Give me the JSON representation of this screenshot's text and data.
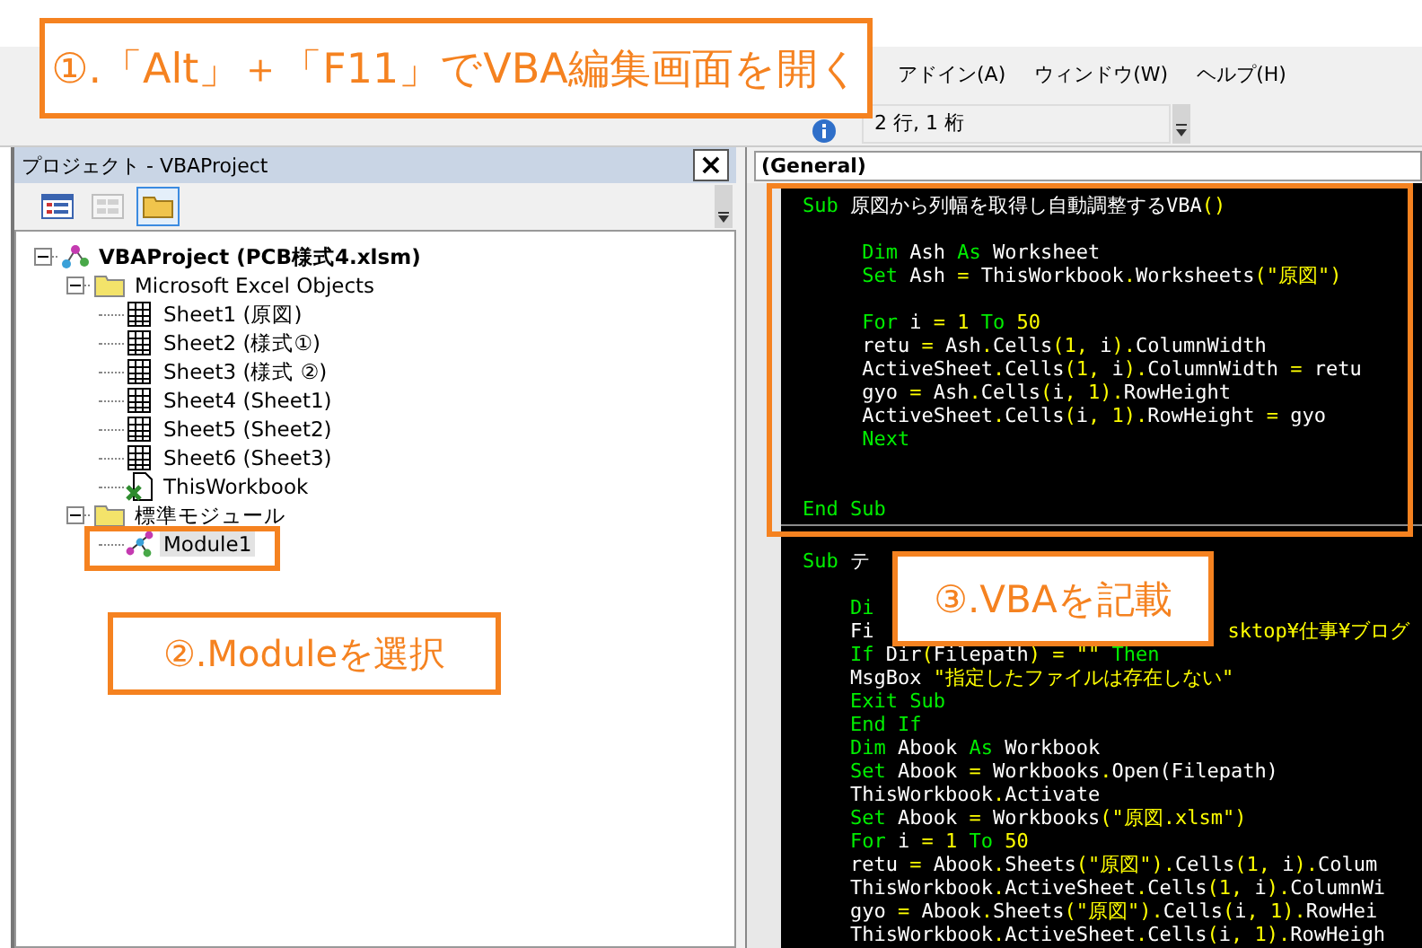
{
  "menu": [
    {
      "label": "アドイン(A)"
    },
    {
      "label": "ウィンドウ(W)"
    },
    {
      "label": "ヘルプ(H)"
    }
  ],
  "toolbar": {
    "position": "2 行, 1 桁"
  },
  "project_panel": {
    "title": "プロジェクト - VBAProject",
    "close": "×",
    "buttons": [
      {
        "kind": "view-code",
        "disabled": false,
        "selected": false
      },
      {
        "kind": "view-object",
        "disabled": true,
        "selected": false
      },
      {
        "kind": "toggle-folders",
        "disabled": false,
        "selected": true
      }
    ],
    "tree": [
      {
        "label": "VBAProject (PCB様式4.xlsm)",
        "kind": "project",
        "expanded": true,
        "selected": false,
        "children": [
          {
            "label": "Microsoft Excel Objects",
            "kind": "folder",
            "expanded": true,
            "selected": false,
            "children": [
              {
                "label": "Sheet1 (原図)",
                "kind": "sheet",
                "selected": false
              },
              {
                "label": "Sheet2 (様式①)",
                "kind": "sheet",
                "selected": false
              },
              {
                "label": "Sheet3 (様式 ②)",
                "kind": "sheet",
                "selected": false
              },
              {
                "label": "Sheet4 (Sheet1)",
                "kind": "sheet",
                "selected": false
              },
              {
                "label": "Sheet5 (Sheet2)",
                "kind": "sheet",
                "selected": false
              },
              {
                "label": "Sheet6 (Sheet3)",
                "kind": "sheet",
                "selected": false
              },
              {
                "label": "ThisWorkbook",
                "kind": "workbook",
                "selected": false
              }
            ]
          },
          {
            "label": "標準モジュール",
            "kind": "folder",
            "expanded": true,
            "selected": false,
            "children": [
              {
                "label": "Module1",
                "kind": "module",
                "selected": true
              }
            ]
          }
        ]
      }
    ]
  },
  "code_window": {
    "object_box": "(General)",
    "procedures": [
      {
        "lines": [
          {
            "kind": "code",
            "segments": [
              {
                "kind": "keyword",
                "text": "Sub "
              },
              {
                "kind": "plain",
                "text": "原図から列幅を取得し自動調整するVBA"
              },
              {
                "kind": "symbol",
                "text": "()"
              }
            ]
          },
          {
            "kind": "blank"
          },
          {
            "kind": "code",
            "segments": [
              {
                "kind": "keyword",
                "text": "     Dim "
              },
              {
                "kind": "plain",
                "text": "Ash "
              },
              {
                "kind": "keyword",
                "text": "As "
              },
              {
                "kind": "plain",
                "text": "Worksheet"
              }
            ]
          },
          {
            "kind": "code",
            "segments": [
              {
                "kind": "keyword",
                "text": "     Set "
              },
              {
                "kind": "plain",
                "text": "Ash "
              },
              {
                "kind": "symbol",
                "text": "= "
              },
              {
                "kind": "plain",
                "text": "ThisWorkbook"
              },
              {
                "kind": "symbol",
                "text": "."
              },
              {
                "kind": "plain",
                "text": "Worksheets"
              },
              {
                "kind": "symbol",
                "text": "(\"原図\")"
              }
            ]
          },
          {
            "kind": "blank"
          },
          {
            "kind": "code",
            "segments": [
              {
                "kind": "keyword",
                "text": "     For "
              },
              {
                "kind": "plain",
                "text": "i "
              },
              {
                "kind": "symbol",
                "text": "= 1 "
              },
              {
                "kind": "keyword",
                "text": "To "
              },
              {
                "kind": "symbol",
                "text": "50"
              }
            ]
          },
          {
            "kind": "code",
            "segments": [
              {
                "kind": "plain",
                "text": "     retu "
              },
              {
                "kind": "symbol",
                "text": "= "
              },
              {
                "kind": "plain",
                "text": "Ash"
              },
              {
                "kind": "symbol",
                "text": "."
              },
              {
                "kind": "plain",
                "text": "Cells"
              },
              {
                "kind": "symbol",
                "text": "(1, "
              },
              {
                "kind": "plain",
                "text": "i"
              },
              {
                "kind": "symbol",
                "text": ")."
              },
              {
                "kind": "plain",
                "text": "ColumnWidth"
              }
            ]
          },
          {
            "kind": "code",
            "segments": [
              {
                "kind": "plain",
                "text": "     ActiveSheet"
              },
              {
                "kind": "symbol",
                "text": "."
              },
              {
                "kind": "plain",
                "text": "Cells"
              },
              {
                "kind": "symbol",
                "text": "(1, "
              },
              {
                "kind": "plain",
                "text": "i"
              },
              {
                "kind": "symbol",
                "text": ")."
              },
              {
                "kind": "plain",
                "text": "ColumnWidth "
              },
              {
                "kind": "symbol",
                "text": "= "
              },
              {
                "kind": "plain",
                "text": "retu"
              }
            ]
          },
          {
            "kind": "code",
            "segments": [
              {
                "kind": "plain",
                "text": "     gyo "
              },
              {
                "kind": "symbol",
                "text": "= "
              },
              {
                "kind": "plain",
                "text": "Ash"
              },
              {
                "kind": "symbol",
                "text": "."
              },
              {
                "kind": "plain",
                "text": "Cells"
              },
              {
                "kind": "symbol",
                "text": "("
              },
              {
                "kind": "plain",
                "text": "i"
              },
              {
                "kind": "symbol",
                "text": ", 1)."
              },
              {
                "kind": "plain",
                "text": "RowHeight"
              }
            ]
          },
          {
            "kind": "code",
            "segments": [
              {
                "kind": "plain",
                "text": "     ActiveSheet"
              },
              {
                "kind": "symbol",
                "text": "."
              },
              {
                "kind": "plain",
                "text": "Cells"
              },
              {
                "kind": "symbol",
                "text": "("
              },
              {
                "kind": "plain",
                "text": "i"
              },
              {
                "kind": "symbol",
                "text": ", 1)."
              },
              {
                "kind": "plain",
                "text": "RowHeight "
              },
              {
                "kind": "symbol",
                "text": "= "
              },
              {
                "kind": "plain",
                "text": "gyo"
              }
            ]
          },
          {
            "kind": "code",
            "segments": [
              {
                "kind": "keyword",
                "text": "     Next"
              }
            ]
          },
          {
            "kind": "blank"
          },
          {
            "kind": "blank"
          },
          {
            "kind": "code",
            "segments": [
              {
                "kind": "keyword",
                "text": "End Sub"
              }
            ]
          }
        ]
      },
      {
        "lines": [
          {
            "kind": "blank"
          },
          {
            "kind": "code",
            "segments": [
              {
                "kind": "keyword",
                "text": "Sub "
              },
              {
                "kind": "plain",
                "text": "テ"
              }
            ]
          },
          {
            "kind": "blank"
          },
          {
            "kind": "code",
            "segments": [
              {
                "kind": "keyword",
                "text": "    Di"
              }
            ]
          },
          {
            "kind": "split",
            "segments": [
              {
                "kind": "plain",
                "text": "    Fi"
              },
              {
                "kind": "symbol",
                "text": "sktop¥仕事¥ブログ"
              }
            ]
          },
          {
            "kind": "code",
            "segments": [
              {
                "kind": "keyword",
                "text": "    If "
              },
              {
                "kind": "plain",
                "text": "Dir"
              },
              {
                "kind": "symbol",
                "text": "("
              },
              {
                "kind": "plain",
                "text": "Filepath"
              },
              {
                "kind": "symbol",
                "text": ") = \"\" "
              },
              {
                "kind": "keyword",
                "text": "Then"
              }
            ]
          },
          {
            "kind": "code",
            "segments": [
              {
                "kind": "plain",
                "text": "    MsgBox "
              },
              {
                "kind": "symbol",
                "text": "\"指定したファイルは存在しない\""
              }
            ]
          },
          {
            "kind": "code",
            "segments": [
              {
                "kind": "keyword",
                "text": "    Exit Sub"
              }
            ]
          },
          {
            "kind": "code",
            "segments": [
              {
                "kind": "keyword",
                "text": "    End If"
              }
            ]
          },
          {
            "kind": "code",
            "segments": [
              {
                "kind": "keyword",
                "text": "    Dim "
              },
              {
                "kind": "plain",
                "text": "Abook "
              },
              {
                "kind": "keyword",
                "text": "As "
              },
              {
                "kind": "plain",
                "text": "Workbook"
              }
            ]
          },
          {
            "kind": "code",
            "segments": [
              {
                "kind": "keyword",
                "text": "    Set "
              },
              {
                "kind": "plain",
                "text": "Abook "
              },
              {
                "kind": "symbol",
                "text": "= "
              },
              {
                "kind": "plain",
                "text": "Workbooks"
              },
              {
                "kind": "symbol",
                "text": "."
              },
              {
                "kind": "plain",
                "text": "Open(Filepath)"
              }
            ]
          },
          {
            "kind": "code",
            "segments": [
              {
                "kind": "plain",
                "text": "    ThisWorkbook"
              },
              {
                "kind": "symbol",
                "text": "."
              },
              {
                "kind": "plain",
                "text": "Activate"
              }
            ]
          },
          {
            "kind": "code",
            "segments": [
              {
                "kind": "keyword",
                "text": "    Set "
              },
              {
                "kind": "plain",
                "text": "Abook "
              },
              {
                "kind": "symbol",
                "text": "= "
              },
              {
                "kind": "plain",
                "text": "Workbooks"
              },
              {
                "kind": "symbol",
                "text": "(\"原図.xlsm\")"
              }
            ]
          },
          {
            "kind": "code",
            "segments": [
              {
                "kind": "keyword",
                "text": "    For "
              },
              {
                "kind": "plain",
                "text": "i "
              },
              {
                "kind": "symbol",
                "text": "= 1 "
              },
              {
                "kind": "keyword",
                "text": "To "
              },
              {
                "kind": "symbol",
                "text": "50"
              }
            ]
          },
          {
            "kind": "code",
            "segments": [
              {
                "kind": "plain",
                "text": "    retu "
              },
              {
                "kind": "symbol",
                "text": "= "
              },
              {
                "kind": "plain",
                "text": "Abook"
              },
              {
                "kind": "symbol",
                "text": "."
              },
              {
                "kind": "plain",
                "text": "Sheets"
              },
              {
                "kind": "symbol",
                "text": "(\"原図\")."
              },
              {
                "kind": "plain",
                "text": "Cells"
              },
              {
                "kind": "symbol",
                "text": "(1, "
              },
              {
                "kind": "plain",
                "text": "i"
              },
              {
                "kind": "symbol",
                "text": ")."
              },
              {
                "kind": "plain",
                "text": "Colum"
              }
            ]
          },
          {
            "kind": "code",
            "segments": [
              {
                "kind": "plain",
                "text": "    ThisWorkbook"
              },
              {
                "kind": "symbol",
                "text": "."
              },
              {
                "kind": "plain",
                "text": "ActiveSheet"
              },
              {
                "kind": "symbol",
                "text": "."
              },
              {
                "kind": "plain",
                "text": "Cells"
              },
              {
                "kind": "symbol",
                "text": "(1, "
              },
              {
                "kind": "plain",
                "text": "i"
              },
              {
                "kind": "symbol",
                "text": ")."
              },
              {
                "kind": "plain",
                "text": "ColumnWi"
              }
            ]
          },
          {
            "kind": "code",
            "segments": [
              {
                "kind": "plain",
                "text": "    gyo "
              },
              {
                "kind": "symbol",
                "text": "= "
              },
              {
                "kind": "plain",
                "text": "Abook"
              },
              {
                "kind": "symbol",
                "text": "."
              },
              {
                "kind": "plain",
                "text": "Sheets"
              },
              {
                "kind": "symbol",
                "text": "(\"原図\")."
              },
              {
                "kind": "plain",
                "text": "Cells"
              },
              {
                "kind": "symbol",
                "text": "("
              },
              {
                "kind": "plain",
                "text": "i"
              },
              {
                "kind": "symbol",
                "text": ", 1)."
              },
              {
                "kind": "plain",
                "text": "RowHei"
              }
            ]
          },
          {
            "kind": "code",
            "segments": [
              {
                "kind": "plain",
                "text": "    ThisWorkbook"
              },
              {
                "kind": "symbol",
                "text": "."
              },
              {
                "kind": "plain",
                "text": "ActiveSheet"
              },
              {
                "kind": "symbol",
                "text": "."
              },
              {
                "kind": "plain",
                "text": "Cells"
              },
              {
                "kind": "symbol",
                "text": "("
              },
              {
                "kind": "plain",
                "text": "i"
              },
              {
                "kind": "symbol",
                "text": ", 1)."
              },
              {
                "kind": "plain",
                "text": "RowHeigh"
              }
            ]
          }
        ]
      }
    ]
  },
  "callouts": [
    {
      "kind": "open",
      "text": "①.「Alt」＋「F11」でVBA編集画面を開く"
    },
    {
      "kind": "select",
      "text": "②.Moduleを選択"
    },
    {
      "kind": "write",
      "text": "③.VBAを記載"
    }
  ]
}
